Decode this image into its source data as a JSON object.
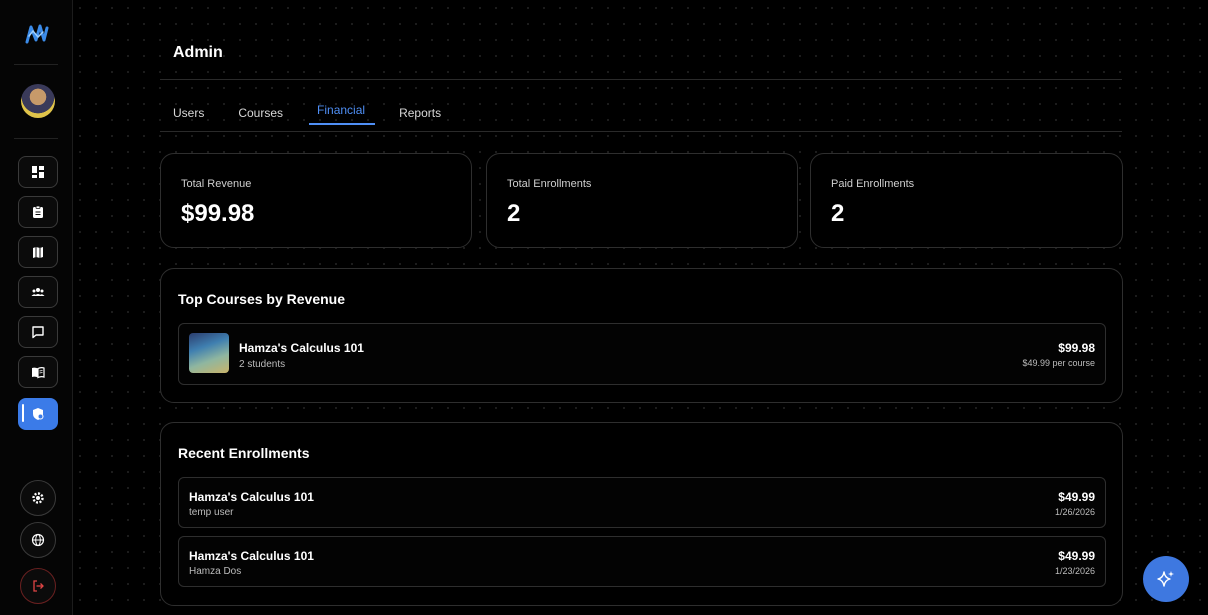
{
  "page": {
    "title": "Admin"
  },
  "tabs": [
    {
      "label": "Users"
    },
    {
      "label": "Courses"
    },
    {
      "label": "Financial",
      "active": true
    },
    {
      "label": "Reports"
    }
  ],
  "stats": [
    {
      "label": "Total Revenue",
      "value": "$99.98"
    },
    {
      "label": "Total Enrollments",
      "value": "2"
    },
    {
      "label": "Paid Enrollments",
      "value": "2"
    }
  ],
  "top_courses": {
    "title": "Top Courses by Revenue",
    "items": [
      {
        "name": "Hamza's Calculus 101",
        "students": "2 students",
        "revenue": "$99.98",
        "price": "$49.99 per course"
      }
    ]
  },
  "recent_enrollments": {
    "title": "Recent Enrollments",
    "items": [
      {
        "course": "Hamza's Calculus 101",
        "user": "temp user",
        "amount": "$49.99",
        "date": "1/26/2026"
      },
      {
        "course": "Hamza's Calculus 101",
        "user": "Hamza Dos",
        "amount": "$49.99",
        "date": "1/23/2026"
      }
    ]
  },
  "sidebar": {
    "icons": [
      "dashboard-icon",
      "clipboard-icon",
      "map-icon",
      "users-icon",
      "chat-icon",
      "book-icon",
      "admin-shield-icon",
      "settings-icon",
      "globe-icon",
      "logout-icon"
    ],
    "active": "admin-shield-icon"
  },
  "fab": {
    "icon": "sparkle-icon"
  },
  "colors": {
    "accent": "#3b7be8",
    "tab_active": "#4f8ff5",
    "background": "#000000",
    "border": "#2e2e2e",
    "logout": "#b03030"
  }
}
